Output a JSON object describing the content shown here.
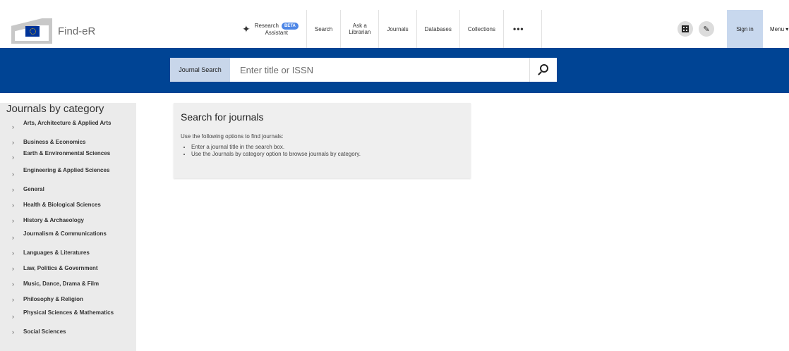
{
  "logo": {
    "text": "Find-eR"
  },
  "nav": {
    "research": {
      "line1": "Research",
      "line2": "Assistant",
      "badge": "BETA"
    },
    "search": "Search",
    "ask": {
      "line1": "Ask a",
      "line2": "Librarian"
    },
    "journals": "Journals",
    "databases": "Databases",
    "collections": "Collections",
    "more": "•••"
  },
  "toolbar": {
    "sign_in": "Sign in",
    "menu": "Menu ▾"
  },
  "search": {
    "tab_label": "Journal Search",
    "placeholder": "Enter title or ISSN"
  },
  "sidebar": {
    "title": "Journals by category",
    "items": [
      {
        "label": "Arts, Architecture & Applied Arts"
      },
      {
        "label": "Business & Economics"
      },
      {
        "label": "Earth & Environmental Sciences"
      },
      {
        "label": "Engineering & Applied Sciences"
      },
      {
        "label": "General"
      },
      {
        "label": "Health & Biological Sciences"
      },
      {
        "label": "History & Archaeology"
      },
      {
        "label": "Journalism & Communications"
      },
      {
        "label": "Languages & Literatures"
      },
      {
        "label": "Law, Politics & Government"
      },
      {
        "label": "Music, Dance, Drama & Film"
      },
      {
        "label": "Philosophy & Religion"
      },
      {
        "label": "Physical Sciences & Mathematics"
      },
      {
        "label": "Social Sciences"
      }
    ]
  },
  "main": {
    "title": "Search for journals",
    "intro": "Use the following options to find journals:",
    "bullets": [
      "Enter a journal title in the search box.",
      "Use the Journals by category option to browse journals by category."
    ]
  },
  "colors": {
    "brand_blue": "#004494",
    "search_tab": "#c8d6ea",
    "sidebar_bg": "#ebebeb"
  }
}
